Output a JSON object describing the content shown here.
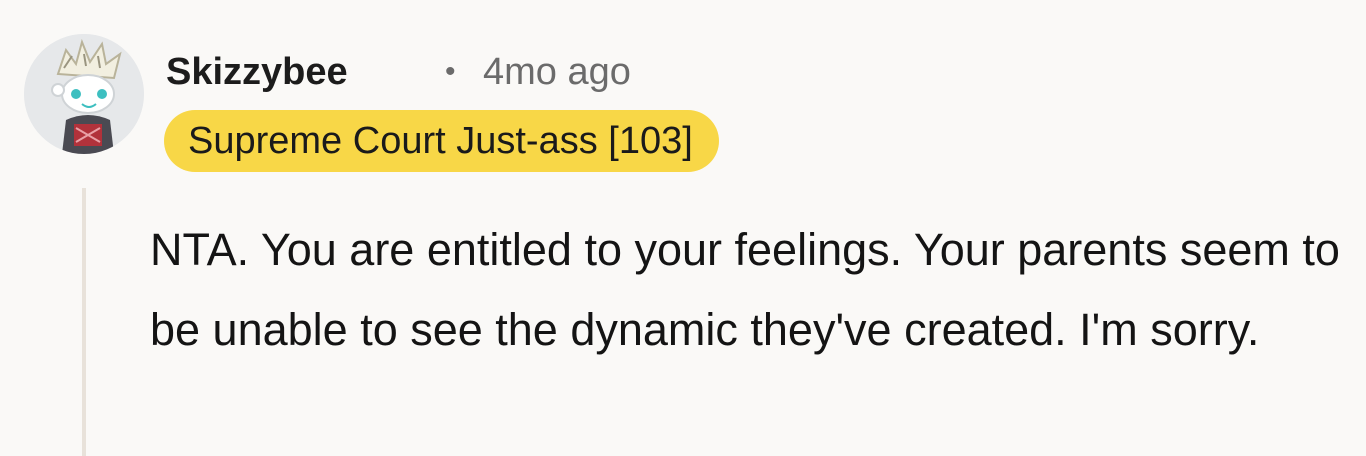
{
  "comment": {
    "username": "Skizzybee",
    "separator": "•",
    "timestamp": "4mo ago",
    "flair": "Supreme Court Just-ass [103]",
    "body": "NTA. You are entitled to your feelings. Your parents seem to be unable to see the dynamic they've created. I'm sorry."
  },
  "avatar": {
    "icon": "snoo-avatar-icon"
  },
  "colors": {
    "background": "#faf9f7",
    "flair_bg": "#f8d747",
    "meta_text": "#6b6b6b",
    "thread_line": "#e8e2da"
  }
}
